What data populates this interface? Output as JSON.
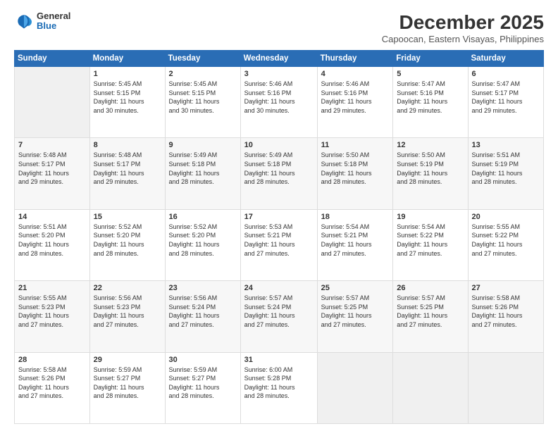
{
  "logo": {
    "general": "General",
    "blue": "Blue"
  },
  "header": {
    "month": "December 2025",
    "location": "Capoocan, Eastern Visayas, Philippines"
  },
  "weekdays": [
    "Sunday",
    "Monday",
    "Tuesday",
    "Wednesday",
    "Thursday",
    "Friday",
    "Saturday"
  ],
  "weeks": [
    [
      {
        "day": "",
        "detail": ""
      },
      {
        "day": "1",
        "detail": "Sunrise: 5:45 AM\nSunset: 5:15 PM\nDaylight: 11 hours\nand 30 minutes."
      },
      {
        "day": "2",
        "detail": "Sunrise: 5:45 AM\nSunset: 5:15 PM\nDaylight: 11 hours\nand 30 minutes."
      },
      {
        "day": "3",
        "detail": "Sunrise: 5:46 AM\nSunset: 5:16 PM\nDaylight: 11 hours\nand 30 minutes."
      },
      {
        "day": "4",
        "detail": "Sunrise: 5:46 AM\nSunset: 5:16 PM\nDaylight: 11 hours\nand 29 minutes."
      },
      {
        "day": "5",
        "detail": "Sunrise: 5:47 AM\nSunset: 5:16 PM\nDaylight: 11 hours\nand 29 minutes."
      },
      {
        "day": "6",
        "detail": "Sunrise: 5:47 AM\nSunset: 5:17 PM\nDaylight: 11 hours\nand 29 minutes."
      }
    ],
    [
      {
        "day": "7",
        "detail": "Sunrise: 5:48 AM\nSunset: 5:17 PM\nDaylight: 11 hours\nand 29 minutes."
      },
      {
        "day": "8",
        "detail": "Sunrise: 5:48 AM\nSunset: 5:17 PM\nDaylight: 11 hours\nand 29 minutes."
      },
      {
        "day": "9",
        "detail": "Sunrise: 5:49 AM\nSunset: 5:18 PM\nDaylight: 11 hours\nand 28 minutes."
      },
      {
        "day": "10",
        "detail": "Sunrise: 5:49 AM\nSunset: 5:18 PM\nDaylight: 11 hours\nand 28 minutes."
      },
      {
        "day": "11",
        "detail": "Sunrise: 5:50 AM\nSunset: 5:18 PM\nDaylight: 11 hours\nand 28 minutes."
      },
      {
        "day": "12",
        "detail": "Sunrise: 5:50 AM\nSunset: 5:19 PM\nDaylight: 11 hours\nand 28 minutes."
      },
      {
        "day": "13",
        "detail": "Sunrise: 5:51 AM\nSunset: 5:19 PM\nDaylight: 11 hours\nand 28 minutes."
      }
    ],
    [
      {
        "day": "14",
        "detail": "Sunrise: 5:51 AM\nSunset: 5:20 PM\nDaylight: 11 hours\nand 28 minutes."
      },
      {
        "day": "15",
        "detail": "Sunrise: 5:52 AM\nSunset: 5:20 PM\nDaylight: 11 hours\nand 28 minutes."
      },
      {
        "day": "16",
        "detail": "Sunrise: 5:52 AM\nSunset: 5:20 PM\nDaylight: 11 hours\nand 28 minutes."
      },
      {
        "day": "17",
        "detail": "Sunrise: 5:53 AM\nSunset: 5:21 PM\nDaylight: 11 hours\nand 27 minutes."
      },
      {
        "day": "18",
        "detail": "Sunrise: 5:54 AM\nSunset: 5:21 PM\nDaylight: 11 hours\nand 27 minutes."
      },
      {
        "day": "19",
        "detail": "Sunrise: 5:54 AM\nSunset: 5:22 PM\nDaylight: 11 hours\nand 27 minutes."
      },
      {
        "day": "20",
        "detail": "Sunrise: 5:55 AM\nSunset: 5:22 PM\nDaylight: 11 hours\nand 27 minutes."
      }
    ],
    [
      {
        "day": "21",
        "detail": "Sunrise: 5:55 AM\nSunset: 5:23 PM\nDaylight: 11 hours\nand 27 minutes."
      },
      {
        "day": "22",
        "detail": "Sunrise: 5:56 AM\nSunset: 5:23 PM\nDaylight: 11 hours\nand 27 minutes."
      },
      {
        "day": "23",
        "detail": "Sunrise: 5:56 AM\nSunset: 5:24 PM\nDaylight: 11 hours\nand 27 minutes."
      },
      {
        "day": "24",
        "detail": "Sunrise: 5:57 AM\nSunset: 5:24 PM\nDaylight: 11 hours\nand 27 minutes."
      },
      {
        "day": "25",
        "detail": "Sunrise: 5:57 AM\nSunset: 5:25 PM\nDaylight: 11 hours\nand 27 minutes."
      },
      {
        "day": "26",
        "detail": "Sunrise: 5:57 AM\nSunset: 5:25 PM\nDaylight: 11 hours\nand 27 minutes."
      },
      {
        "day": "27",
        "detail": "Sunrise: 5:58 AM\nSunset: 5:26 PM\nDaylight: 11 hours\nand 27 minutes."
      }
    ],
    [
      {
        "day": "28",
        "detail": "Sunrise: 5:58 AM\nSunset: 5:26 PM\nDaylight: 11 hours\nand 27 minutes."
      },
      {
        "day": "29",
        "detail": "Sunrise: 5:59 AM\nSunset: 5:27 PM\nDaylight: 11 hours\nand 28 minutes."
      },
      {
        "day": "30",
        "detail": "Sunrise: 5:59 AM\nSunset: 5:27 PM\nDaylight: 11 hours\nand 28 minutes."
      },
      {
        "day": "31",
        "detail": "Sunrise: 6:00 AM\nSunset: 5:28 PM\nDaylight: 11 hours\nand 28 minutes."
      },
      {
        "day": "",
        "detail": ""
      },
      {
        "day": "",
        "detail": ""
      },
      {
        "day": "",
        "detail": ""
      }
    ]
  ]
}
